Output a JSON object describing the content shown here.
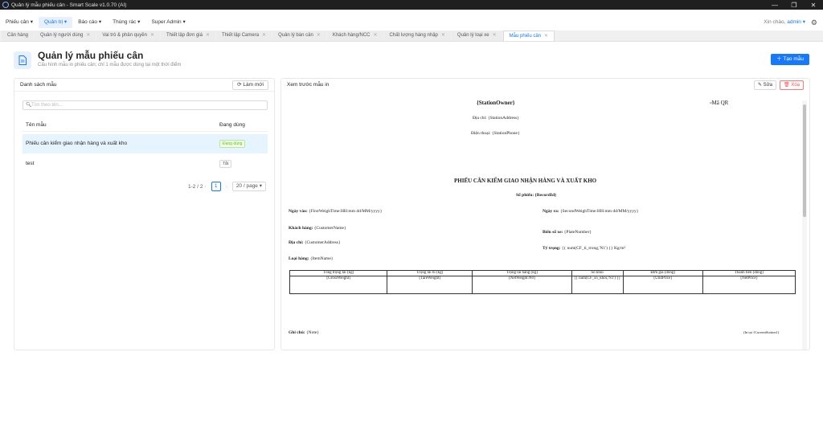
{
  "window": {
    "title": "Quản lý mẫu phiếu cân - Smart Scale v1.0.70 (AI)"
  },
  "menu": [
    {
      "label": "Phiếu cân ▾"
    },
    {
      "label": "Quản trị ▾"
    },
    {
      "label": "Báo cáo ▾"
    },
    {
      "label": "Thùng rác ▾"
    },
    {
      "label": "Super Admin ▾"
    }
  ],
  "header": {
    "greeting": "Xin chào,",
    "user": "admin ▾"
  },
  "tabs": [
    {
      "label": "Cân hàng"
    },
    {
      "label": "Quản lý người dùng"
    },
    {
      "label": "Vai trò & phân quyền"
    },
    {
      "label": "Thiết lập đơn giá"
    },
    {
      "label": "Thiết lập Camera"
    },
    {
      "label": "Quản lý bàn cân"
    },
    {
      "label": "Khách hàng/NCC"
    },
    {
      "label": "Chất lượng hàng nhập"
    },
    {
      "label": "Quản lý loại xe"
    },
    {
      "label": "Mẫu phiếu cân"
    }
  ],
  "page": {
    "title": "Quản lý mẫu phiếu cân",
    "subtitle": "Cấu hình mẫu in phiếu cân; chỉ 1 mẫu được dùng tại một thời điểm",
    "create_label": "Tạo mẫu"
  },
  "list_panel": {
    "title": "Danh sách mẫu",
    "refresh_label": "Làm mới",
    "search_placeholder": "Tìm theo tên...",
    "col_name": "Tên mẫu",
    "col_status": "Đang dùng",
    "rows": [
      {
        "name": "Phiếu cân kiểm giao nhận hàng và xuất kho",
        "status": "Đang dùng"
      },
      {
        "name": "test",
        "status": "Tắt"
      }
    ],
    "range": "1-2 / 2",
    "page": "1",
    "page_size": "20 / page"
  },
  "preview_panel": {
    "title": "Xem trước mẫu in",
    "edit_label": "Sửa",
    "delete_label": "Xóa"
  },
  "doc": {
    "owner": "{StationOwner}",
    "qr": "Mã QR",
    "address": "Địa chỉ: {StationAddress}",
    "phone": "Điện thoại: {StationPhone}",
    "heading": "PHIẾU CÂN KIỂM GIAO NHẬN HÀNG VÀ XUẤT KHO",
    "record": "Số phiếu: {RecordId}",
    "date_in_label": "Ngày vào:",
    "date_in_val": "{FirstWeighTime:HH:mm dd/MM/yyyy}",
    "date_out_label": "Ngày ra:",
    "date_out_val": "{SecondWeighTime:HH:mm dd/MM/yyyy}",
    "customer_label": "Khách hàng:",
    "customer_val": "{CustomerName}",
    "plate_label": "Biển số xe:",
    "plate_val": "{PlateNumber}",
    "addr_label": "Địa chỉ:",
    "addr_val": "{CustomerAddress}",
    "density_label": "Tỷ trọng:",
    "density_val": "{{ num(CF_ti_trong,'N1') }} Kg/m³",
    "item_label": "Loại hàng:",
    "item_val": "{ItemName}",
    "table_headers": [
      "Tổng trọng tải (kg)",
      "Trọng tải bì (kg)",
      "Trọng tải hàng (kg)",
      "Số khối",
      "Đơn giá (đồng)",
      "Thành tiền (đồng)"
    ],
    "table_row": [
      "{GrossWeight}",
      "{TareWeight}",
      "{NetWeight:N0}",
      "{{ num(CF_so_khoi,'N1') }}",
      "{UnitPrice}",
      "{NetPrice}"
    ],
    "note_label": "Ghi chú:",
    "note_val": "{Note}",
    "printed_at": "(In tại {CurrentStation})"
  }
}
